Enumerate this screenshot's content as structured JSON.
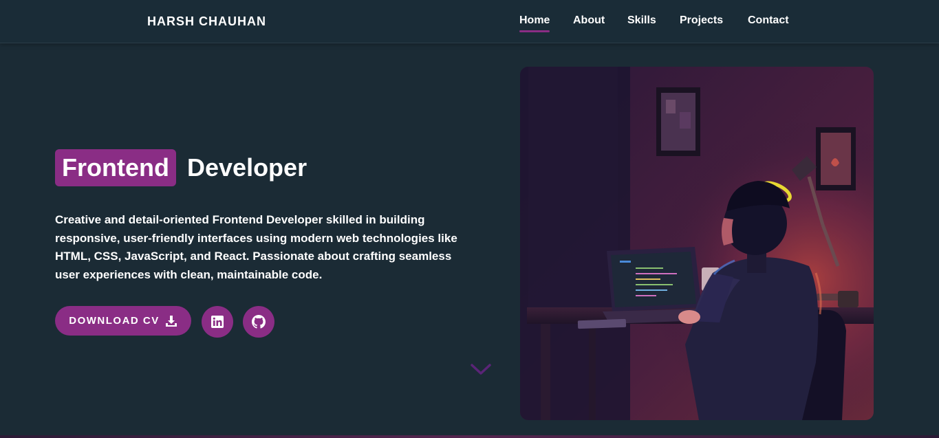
{
  "brand": "HARSH CHAUHAN",
  "nav": {
    "home": "Home",
    "about": "About",
    "skills": "Skills",
    "projects": "Projects",
    "contact": "Contact"
  },
  "hero": {
    "title_highlight": "Frontend",
    "title_rest": "Developer",
    "description": "Creative and detail-oriented Frontend Developer skilled in building responsive, user-friendly interfaces using modern web technologies like HTML, CSS, JavaScript, and React. Passionate about crafting seamless user experiences with clean, maintainable code.",
    "cv_button": "DOWNLOAD CV"
  },
  "icons": {
    "download": "download-icon",
    "linkedin": "linkedin-icon",
    "github": "github-icon",
    "scroll": "chevron-down-icon"
  },
  "colors": {
    "background": "#1b2b35",
    "accent": "#8a2d85",
    "text": "#ffffff"
  }
}
